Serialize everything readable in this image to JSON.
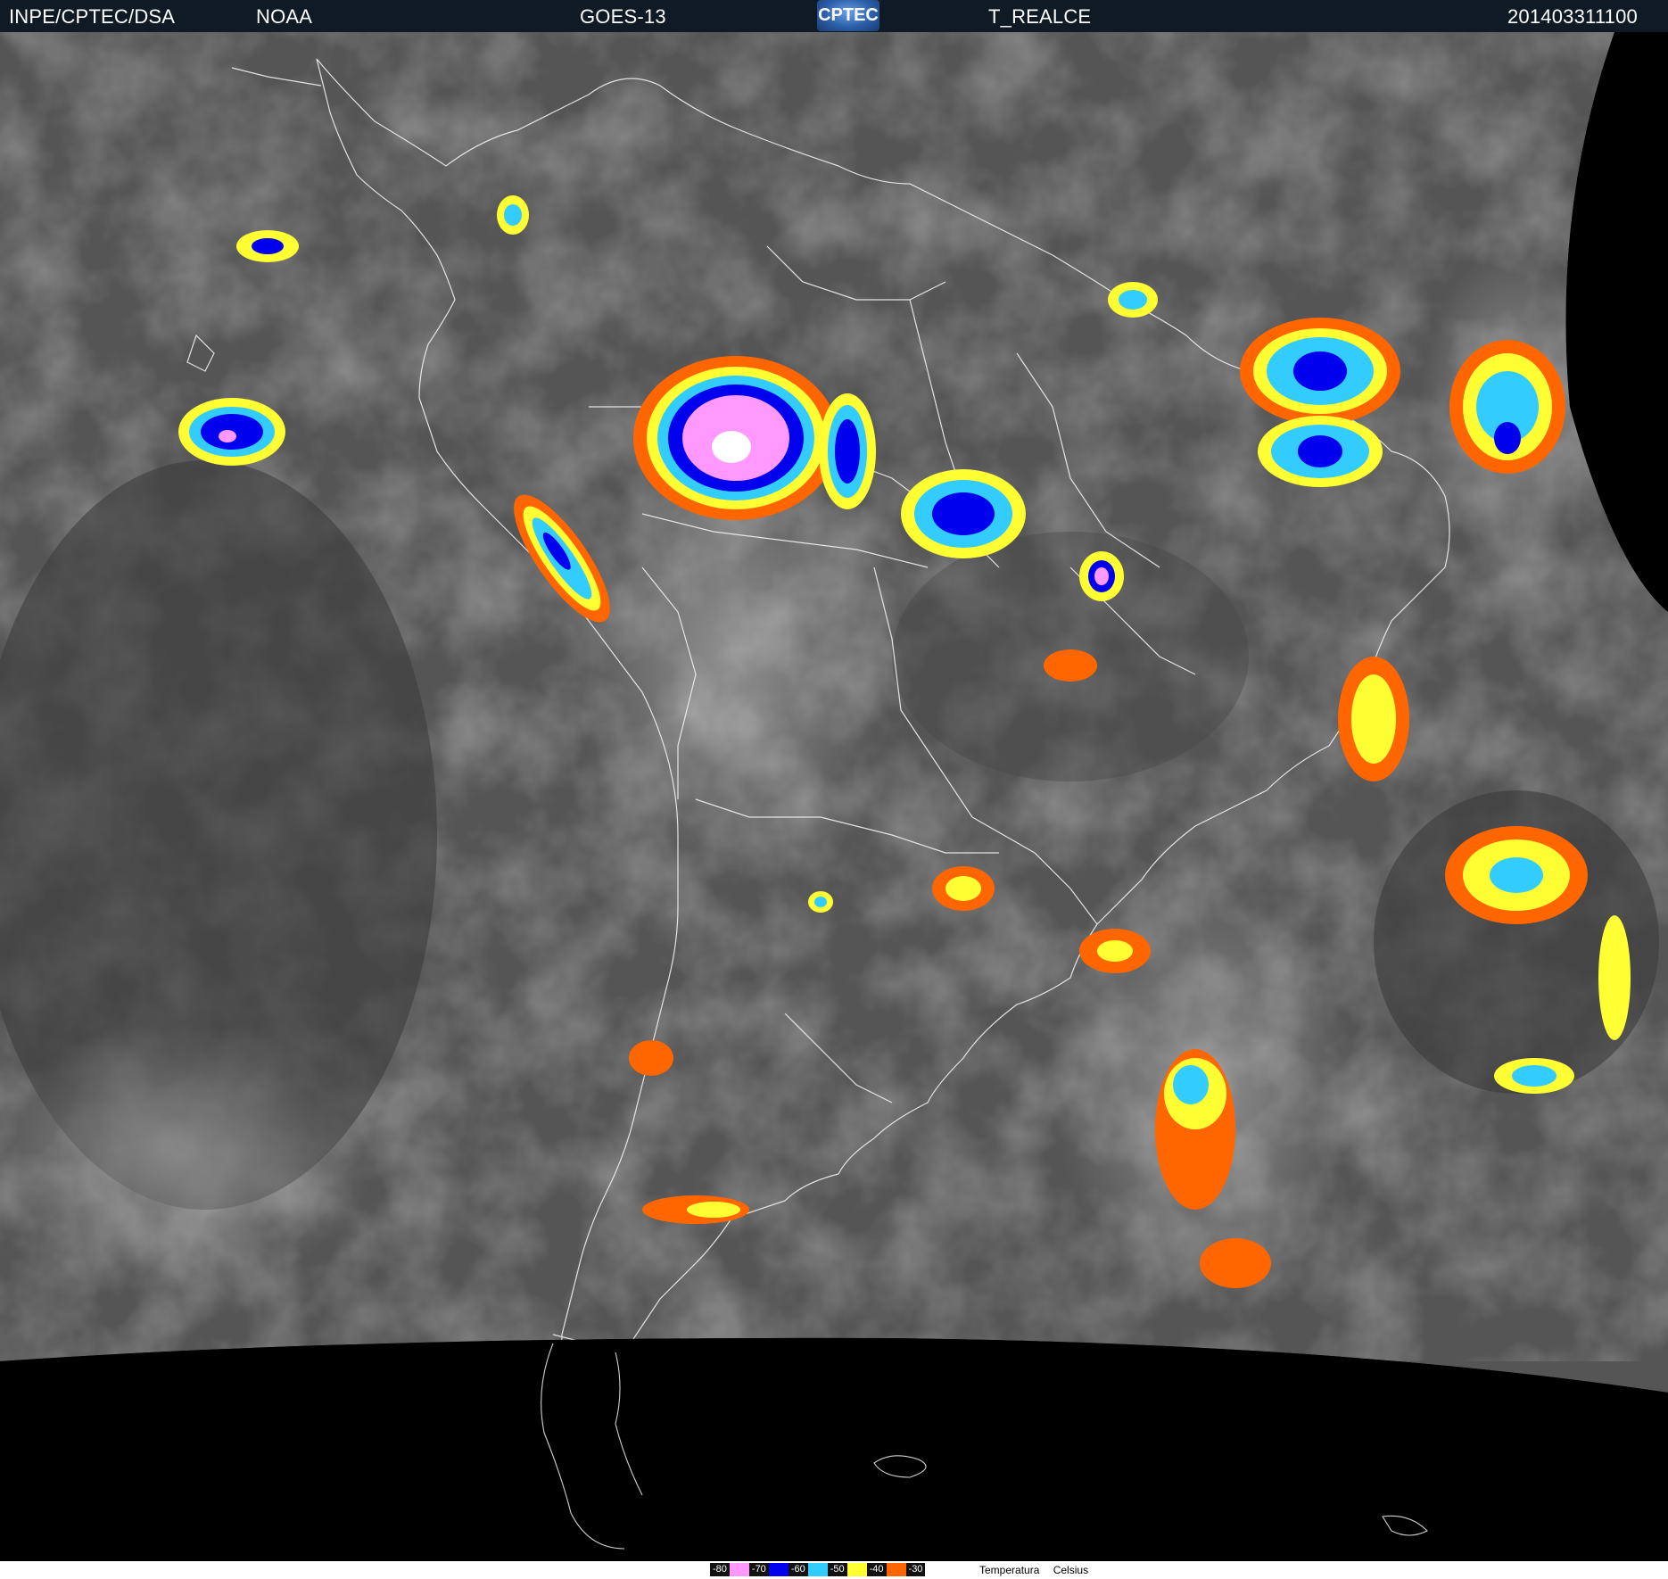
{
  "header": {
    "org": "INPE/CPTEC/DSA",
    "agency": "NOAA",
    "satellite": "GOES-13",
    "logo_text": "CPTEC",
    "product": "T_REALCE",
    "timestamp": "201403311100"
  },
  "legend": {
    "entries": [
      {
        "label": "-80",
        "color": "#ff99ff"
      },
      {
        "label": "-70",
        "color": "#0000ee"
      },
      {
        "label": "-60",
        "color": "#33ccff"
      },
      {
        "label": "-50",
        "color": "#ffff33"
      },
      {
        "label": "-40",
        "color": "#ff6600"
      },
      {
        "label": "-30",
        "color": "#ffffff"
      }
    ],
    "caption_word1": "Temperatura",
    "caption_word2": "Celsius"
  }
}
